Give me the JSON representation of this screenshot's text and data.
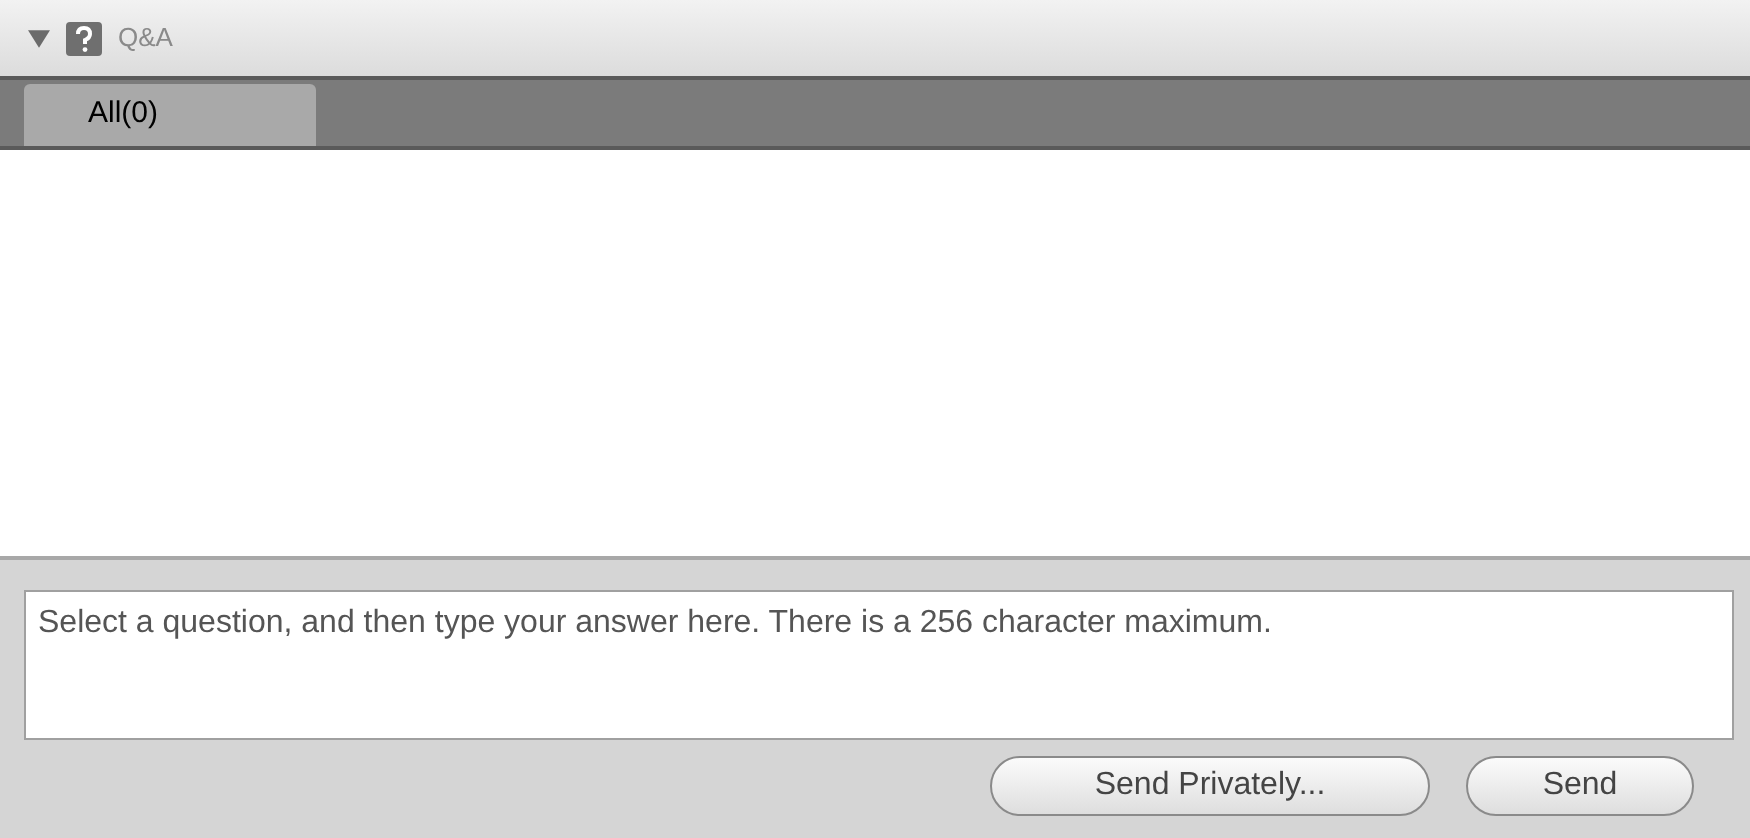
{
  "panel": {
    "title": "Q&A",
    "expanded": true
  },
  "tabs": [
    {
      "label": "All(0)",
      "selected": true
    }
  ],
  "answer": {
    "placeholder": "Select a question, and then type your answer here. There is a 256 character maximum."
  },
  "buttons": [
    "Send Privately...",
    "Send"
  ]
}
